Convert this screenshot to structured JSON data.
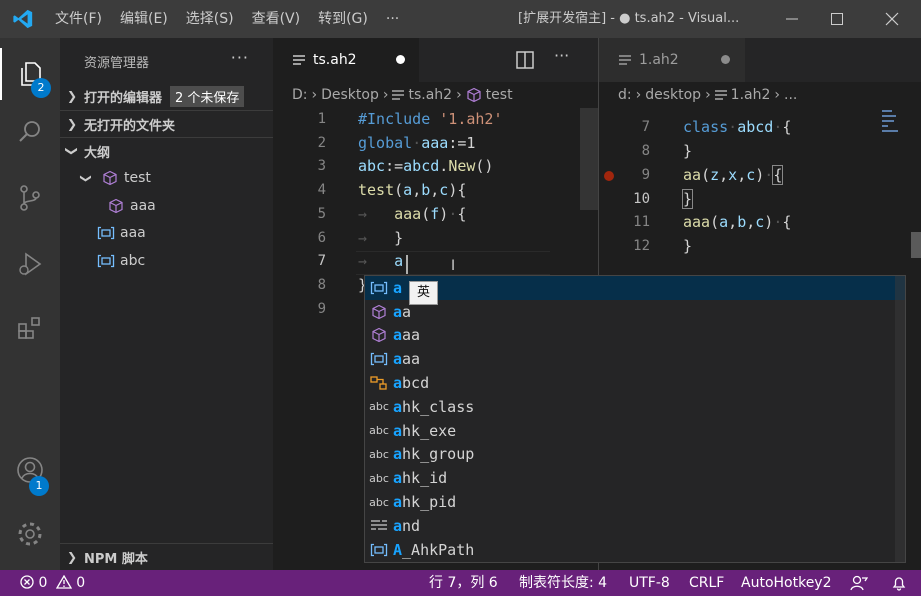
{
  "titlebar": {
    "menu": [
      "文件(F)",
      "编辑(E)",
      "选择(S)",
      "查看(V)",
      "转到(G)",
      "···"
    ],
    "title": "[扩展开发宿主] - ● ts.ah2 - Visual..."
  },
  "activity": {
    "explorer_badge": "2",
    "account_badge": "1"
  },
  "sidebar": {
    "title": "资源管理器",
    "more": "···",
    "open_editors": "打开的编辑器",
    "unsaved": "2 个未保存",
    "no_folder": "无打开的文件夹",
    "outline": "大纲",
    "outline_items": [
      {
        "label": "test"
      },
      {
        "label": "aaa"
      },
      {
        "label": "aaa"
      },
      {
        "label": "abc"
      }
    ],
    "npm": "NPM 脚本"
  },
  "left_editor": {
    "tab": "ts.ah2",
    "crumbs": [
      "D:",
      "Desktop",
      "ts.ah2",
      "test"
    ],
    "lines": [
      "1",
      "2",
      "3",
      "4",
      "5",
      "6",
      "7",
      "8",
      "9"
    ]
  },
  "right_editor": {
    "tab": "1.ah2",
    "crumbs": [
      "d:",
      "desktop",
      "1.ah2",
      "..."
    ],
    "lines": [
      "7",
      "8",
      "9",
      "10",
      "11",
      "12"
    ]
  },
  "suggest": {
    "items": [
      {
        "hl": "a",
        "rest": "",
        "kind": "variable"
      },
      {
        "hl": "a",
        "rest": "a",
        "kind": "class"
      },
      {
        "hl": "a",
        "rest": "aa",
        "kind": "class"
      },
      {
        "hl": "a",
        "rest": "aa",
        "kind": "variable"
      },
      {
        "hl": "a",
        "rest": "bcd",
        "kind": "class-orange"
      },
      {
        "hl": "a",
        "rest": "hk_class",
        "kind": "text"
      },
      {
        "hl": "a",
        "rest": "hk_exe",
        "kind": "text"
      },
      {
        "hl": "a",
        "rest": "hk_group",
        "kind": "text"
      },
      {
        "hl": "a",
        "rest": "hk_id",
        "kind": "text"
      },
      {
        "hl": "a",
        "rest": "hk_pid",
        "kind": "text"
      },
      {
        "hl": "a",
        "rest": "nd",
        "kind": "keyword"
      },
      {
        "hl": "A",
        "rest": "_AhkPath",
        "kind": "variable"
      }
    ],
    "text_icon": "abc",
    "ime": "英"
  },
  "status": {
    "errors": "0",
    "warnings": "0",
    "position": "行 7，列 6",
    "indent": "制表符长度: 4",
    "encoding": "UTF-8",
    "eol": "CRLF",
    "language": "AutoHotkey2"
  },
  "colors": {
    "status_bg": "#68217a",
    "accent": "#007acc",
    "highlight": "#18a3ff"
  }
}
